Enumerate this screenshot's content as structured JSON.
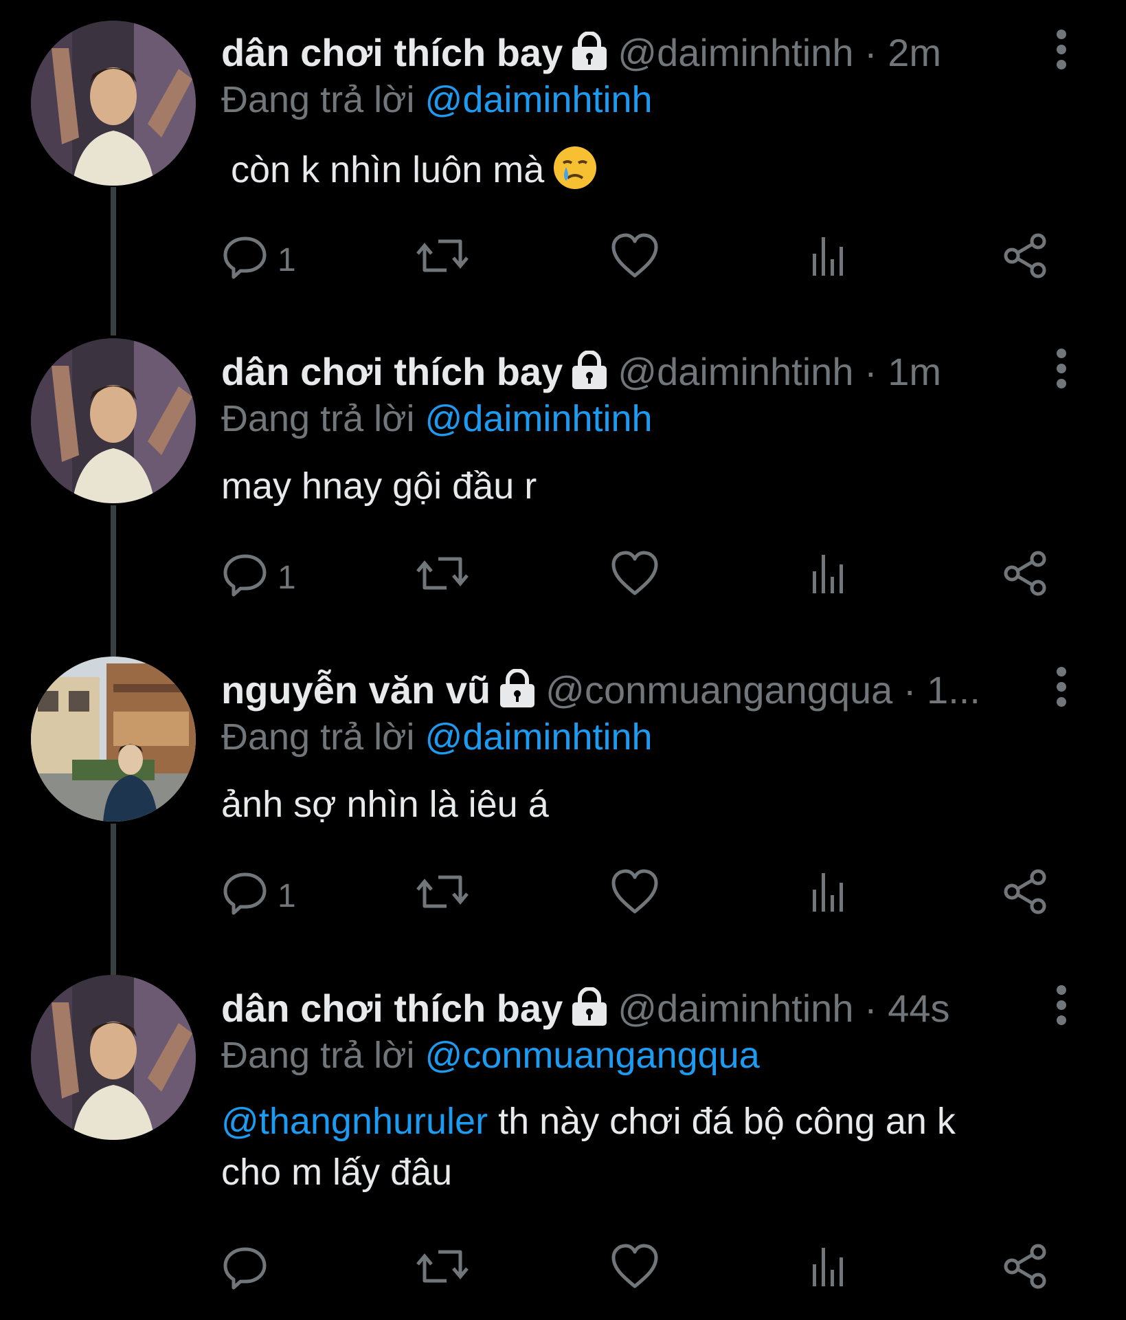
{
  "tweets": [
    {
      "name": "dân chơi thích bay",
      "handle": "@daiminhtinh",
      "time": "2m",
      "reply_prefix": "Đang trả lời",
      "reply_to": "@daiminhtinh",
      "text": "còn k nhìn luôn mà",
      "emoji": "crying-face-with-tear-emoji",
      "reply_count": "1",
      "avatar": "man-with-tattoos-photo"
    },
    {
      "name": "dân chơi thích bay",
      "handle": "@daiminhtinh",
      "time": "1m",
      "reply_prefix": "Đang trả lời",
      "reply_to": "@daiminhtinh",
      "text": "may hnay gội đầu r",
      "reply_count": "1",
      "avatar": "man-with-tattoos-photo"
    },
    {
      "name": "nguyễn văn vũ",
      "handle": "@conmuangangqua · 1...",
      "reply_prefix": "Đang trả lời",
      "reply_to": "@daiminhtinh",
      "text": "ảnh sợ nhìn là iêu á",
      "reply_count": "1",
      "avatar": "man-on-street-photo"
    },
    {
      "name": "dân chơi thích bay",
      "handle": "@daiminhtinh",
      "time": "44s",
      "reply_prefix": "Đang trả lời",
      "reply_to": "@conmuangangqua",
      "text_mention": "@thangnhuruler",
      "text_line1": " th này chơi đá bộ công an k",
      "text_line2": "cho m lấy đâu",
      "reply_count": "",
      "avatar": "man-with-tattoos-photo"
    }
  ],
  "separator": " · ",
  "colors": {
    "background": "#000000",
    "text": "#e7e9ea",
    "secondary": "#71767b",
    "link": "#1d9bf0"
  }
}
